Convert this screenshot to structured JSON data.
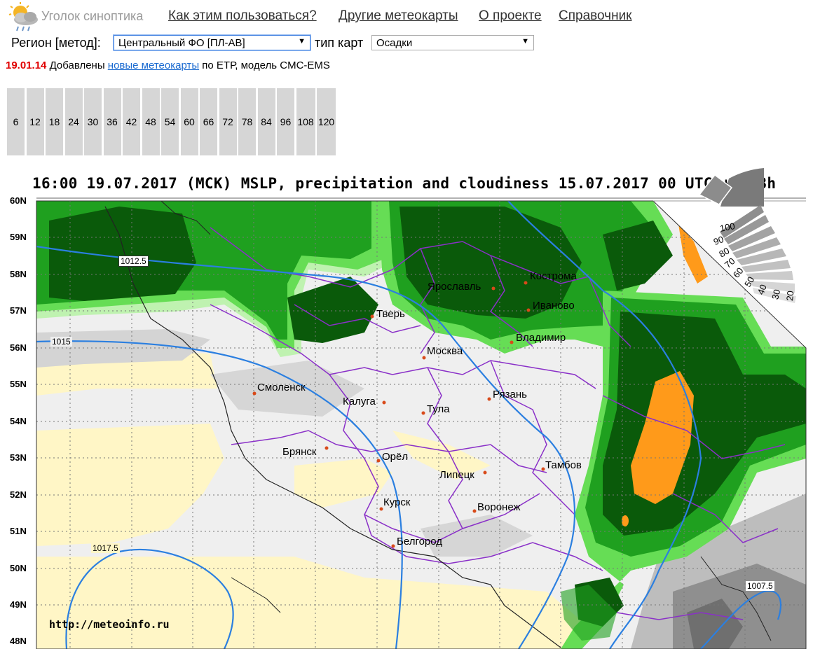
{
  "header": {
    "brand": "Уголок синоптика",
    "nav": [
      "Как этим пользоваться?",
      "Другие метеокарты",
      "О проекте",
      "Справочник"
    ]
  },
  "controls": {
    "region_label": "Регион [метод]:",
    "region_value": "Центральный ФО [ПЛ-АВ]",
    "type_label": "тип карт",
    "type_value": "Осадки"
  },
  "news": {
    "date": "19.01.14",
    "text_before": "Добавлены",
    "link": "новые метеокарты",
    "text_after": "по ЕТР, модель CMC-EMS"
  },
  "hours": [
    "6",
    "12",
    "18",
    "24",
    "30",
    "36",
    "42",
    "48",
    "54",
    "60",
    "66",
    "72",
    "78",
    "84",
    "96",
    "108",
    "120"
  ],
  "map": {
    "title": "16:00 19.07.2017 (МСК) MSLP, precipitation and cloudiness 15.07.2017 00 UTC + 108h",
    "lat_labels": [
      "60N",
      "59N",
      "58N",
      "57N",
      "56N",
      "55N",
      "54N",
      "53N",
      "52N",
      "51N",
      "50N",
      "49N",
      "48N"
    ],
    "isobars": [
      "1012.5",
      "1015",
      "1017.5",
      "1007.5"
    ],
    "cloud_scale": [
      "100",
      "90",
      "80",
      "70",
      "60",
      "50",
      "40",
      "30",
      "20"
    ],
    "cities": [
      "Кострома",
      "Ярославль",
      "Иваново",
      "Тверь",
      "Владимир",
      "Москва",
      "Смоленск",
      "Рязань",
      "Калуга",
      "Тула",
      "Брянск",
      "Орёл",
      "Тамбов",
      "Липецк",
      "Курск",
      "Воронеж",
      "Белгород"
    ],
    "credit": "http://meteoinfo.ru",
    "colors": {
      "dark_green": "#0a5a0a",
      "green": "#1fa01f",
      "light_green": "#66dd55",
      "pale_green": "#bff2b0",
      "orange": "#ff9a1a",
      "cloud_light": "#efefef",
      "cloud_mid": "#cfcfcf",
      "clear": "#fff6c6",
      "isobar": "#2b7fe0",
      "border": "#8a30c8"
    }
  }
}
